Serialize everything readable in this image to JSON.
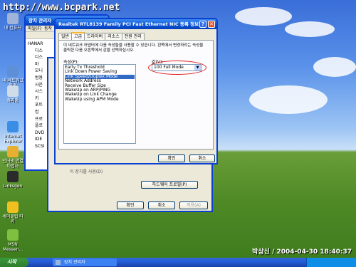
{
  "watermark": "http://www.bcpark.net",
  "signature": "박상신 / 2004-04-30 18:40:37",
  "desktop_icons": [
    {
      "label": "내 컴퓨터",
      "icon": "my-computer-icon",
      "color": "#9fb4d8"
    },
    {
      "label": "내 네트워크 환경",
      "icon": "network-places-icon",
      "color": "#5f8fd6"
    },
    {
      "label": "휴지통",
      "icon": "recycle-bin-icon",
      "color": "#d0dce8"
    },
    {
      "label": "Internet Explorer",
      "icon": "internet-explorer-icon",
      "color": "#3a8ee6"
    },
    {
      "label": "인터넷 연결 마법사",
      "icon": "connection-wizard-icon",
      "color": "#e8b030"
    },
    {
      "label": "Linksgen",
      "icon": "linksgen-icon",
      "color": "#2a2a2a"
    },
    {
      "label": "세이클럽 타키",
      "icon": "sayclub-icon",
      "color": "#f0c020"
    },
    {
      "label": "MSN Messen...",
      "icon": "msn-messenger-icon",
      "color": "#7fc040"
    }
  ],
  "device_manager": {
    "title": "장치 관리자",
    "menu": [
      "파일(F)",
      "동작"
    ],
    "tree_root": "HANAR",
    "tree_items": [
      "디스",
      "디스",
      "마",
      "모니",
      "범용",
      "사운",
      "시스",
      "키",
      "포트",
      "컴",
      "프로",
      "플로",
      "DVD",
      "IDE",
      "SCSI"
    ]
  },
  "properties": {
    "label_text": "이 장치를 사용(D)",
    "hardware_button": "하드웨어 프로필(P)",
    "ok": "확인",
    "cancel": "취소",
    "apply": "적용(A)"
  },
  "dialog": {
    "title": "Realtek RTL8139 Family PCI Fast Ethernet NIC 등록 정보",
    "tabs": [
      "일반",
      "고급",
      "드라이버",
      "리소스",
      "전원 관리"
    ],
    "active_tab": 1,
    "description": "이 네트워크 어댑터에 다음 속성들을 사용할 수 있습니다. 왼쪽에서 변경하려는 속성을 클릭한 다음 오른쪽에서 값을 선택하십시오.",
    "property_label": "속성(P):",
    "value_label": "값(V):",
    "properties": [
      "Early Tx Threshold",
      "Link Down Power Saving",
      "Link Speed/Duplex Mode",
      "Network Address",
      "Receive Buffer Size",
      "WakeUp on ARP/PING",
      "WakeUp on Link Change",
      "WakeUp using APM Mode"
    ],
    "selected_index": 2,
    "value": "100 Full Mode",
    "ok": "확인",
    "cancel": "취소",
    "help": "?"
  },
  "taskbar": {
    "start": "시작",
    "task": "장치 관리자"
  }
}
